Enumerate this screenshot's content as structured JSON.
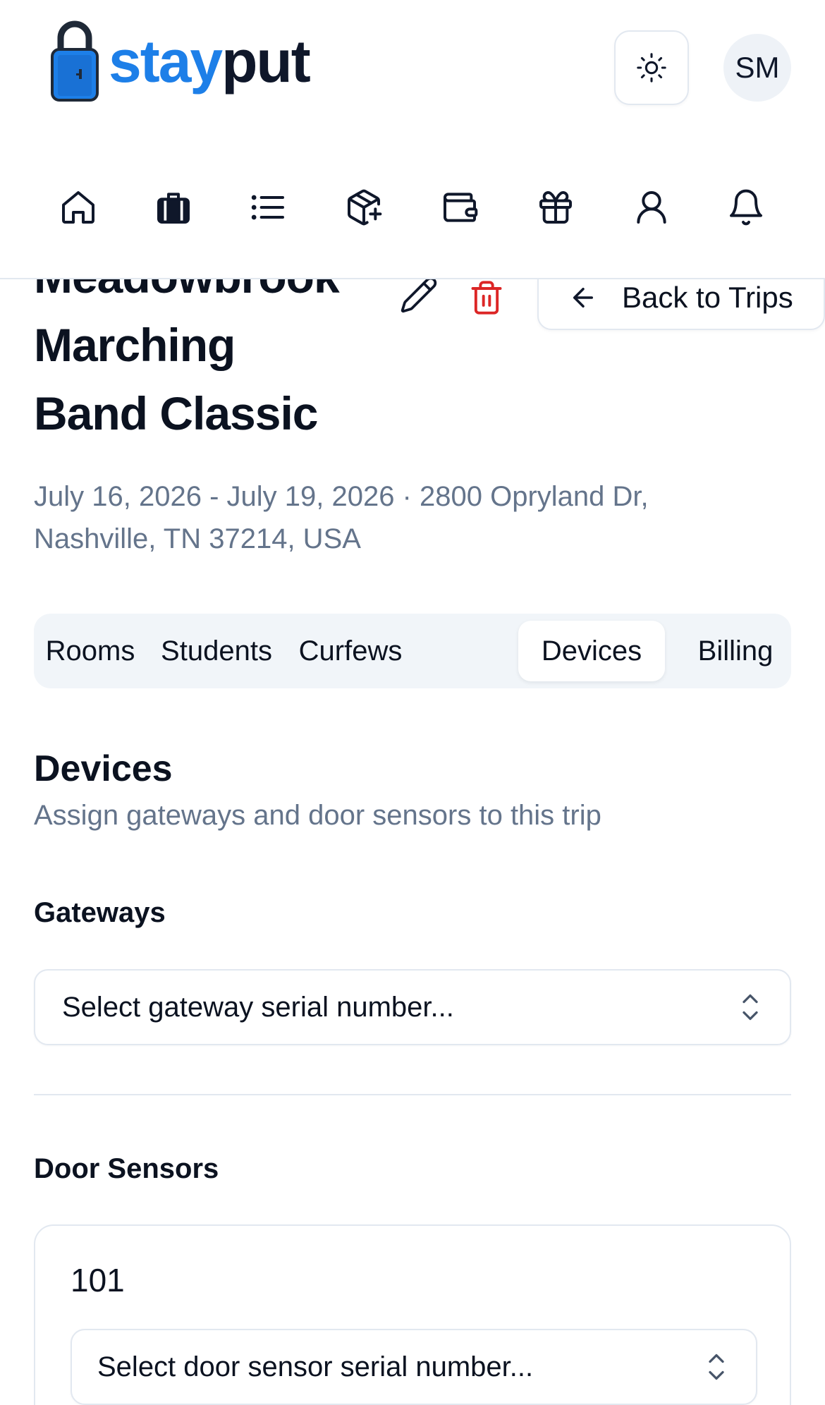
{
  "brand": {
    "name_part1": "stay",
    "name_part2": "put",
    "lock_color": "#1d7fe8",
    "accent": "#1d7fe8"
  },
  "header": {
    "theme_icon": "sun-icon",
    "avatar_initials": "SM"
  },
  "nav": {
    "items": [
      {
        "icon": "home-icon"
      },
      {
        "icon": "luggage-icon"
      },
      {
        "icon": "list-icon"
      },
      {
        "icon": "package-plus-icon"
      },
      {
        "icon": "wallet-icon"
      },
      {
        "icon": "gift-icon"
      },
      {
        "icon": "user-icon"
      },
      {
        "icon": "bell-icon"
      }
    ]
  },
  "trip": {
    "title_lines": [
      "Meadowbrook",
      "Marching",
      "Band Classic"
    ],
    "meta_line1": "July 16, 2026 - July 19, 2026 · 2800 Opryland Dr,",
    "meta_line2": "Nashville, TN 37214, USA",
    "back_label": "Back to Trips",
    "delete_color": "#dc2626"
  },
  "tabs": [
    {
      "label": "Rooms",
      "active": false
    },
    {
      "label": "Students",
      "active": false
    },
    {
      "label": "Curfews",
      "active": false
    },
    {
      "label": "Devices",
      "active": true
    },
    {
      "label": "Billing",
      "active": false
    }
  ],
  "devices": {
    "title": "Devices",
    "subtitle": "Assign gateways and door sensors to this trip",
    "gateways_label": "Gateways",
    "gateway_placeholder": "Select gateway serial number...",
    "door_sensors_label": "Door Sensors",
    "sensors": [
      {
        "room": "101",
        "placeholder": "Select door sensor serial number..."
      }
    ]
  }
}
